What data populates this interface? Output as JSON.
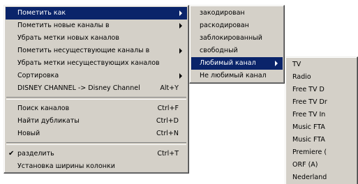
{
  "main_menu": {
    "items": [
      {
        "label": "Пометить как",
        "submenu": true
      },
      {
        "label": "Пометить новые каналы в",
        "submenu": true
      },
      {
        "label": "Убрать метки новых каналов"
      },
      {
        "label": "Пометить несуществующие каналы в",
        "submenu": true
      },
      {
        "label": "Убрать метки несуществующих каналов"
      },
      {
        "label": "Сортировка",
        "submenu": true
      },
      {
        "label": "DISNEY CHANNEL -> Disney Channel",
        "shortcut": "Alt+Y"
      },
      {
        "label": "Поиск каналов",
        "shortcut": "Ctrl+F"
      },
      {
        "label": "Найти дубликаты",
        "shortcut": "Ctrl+D"
      },
      {
        "label": "Новый",
        "shortcut": "Ctrl+N"
      },
      {
        "label": "разделить",
        "shortcut": "Ctrl+T",
        "checked": true
      },
      {
        "label": "Установка ширины колонки"
      }
    ]
  },
  "mark_as_menu": {
    "items": [
      {
        "label": "закодирован"
      },
      {
        "label": "раскодирован"
      },
      {
        "label": "заблокированный"
      },
      {
        "label": "свободный"
      },
      {
        "label": "Любимый канал",
        "submenu": true
      },
      {
        "label": "Не любимый канал"
      }
    ]
  },
  "favorite_menu": {
    "items": [
      {
        "label": "TV"
      },
      {
        "label": "Radio"
      },
      {
        "label": "Free TV D"
      },
      {
        "label": "Free TV Dr"
      },
      {
        "label": "Free TV In"
      },
      {
        "label": "Music FTA"
      },
      {
        "label": "Music FTA"
      },
      {
        "label": "Premiere ("
      },
      {
        "label": "ORF (A)"
      },
      {
        "label": "Nederland"
      }
    ]
  },
  "check_glyph": "✔",
  "colors": {
    "menu_bg": "#d4d0c8",
    "highlight": "#0a246a",
    "highlight_text": "#ffffff"
  }
}
